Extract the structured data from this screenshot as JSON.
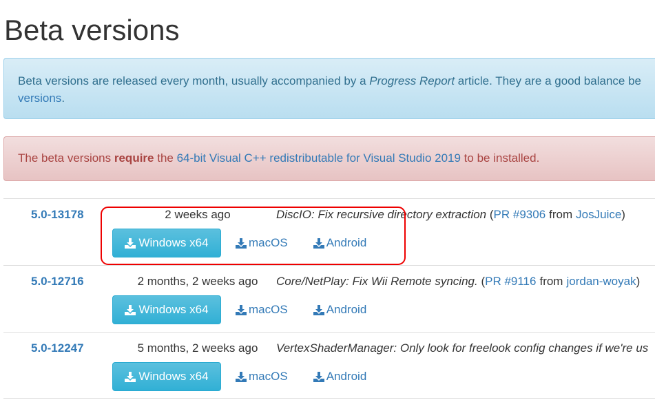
{
  "title": "Beta versions",
  "info": {
    "text1": "Beta versions are released every month, usually accompanied by a ",
    "em": "Progress Report",
    "text2": " article. They are a good balance be",
    "link": "versions",
    "end": "."
  },
  "danger": {
    "text1": "The beta versions ",
    "strong": "require",
    "text2": " the ",
    "link": "64-bit Visual C++ redistributable for Visual Studio 2019",
    "text3": " to be installed."
  },
  "colors": {
    "link": "#337ab7",
    "button": "#31b0d5",
    "highlight": "#e00000"
  },
  "buttons": {
    "windows": "Windows x64",
    "macos": "macOS",
    "android": "Android",
    "icon": "download-icon"
  },
  "rows": [
    {
      "version": "5.0-13178",
      "date": "2 weeks ago",
      "desc": "DiscIO: Fix recursive directory extraction",
      "pr": "PR #9306",
      "from": "from",
      "author": "JosJuice",
      "open": " (",
      "close": ")"
    },
    {
      "version": "5.0-12716",
      "date": "2 months, 2 weeks ago",
      "desc": "Core/NetPlay: Fix Wii Remote syncing.",
      "pr": "PR #9116",
      "from": "from",
      "author": "jordan-woyak",
      "open": " (",
      "close": ")"
    },
    {
      "version": "5.0-12247",
      "date": "5 months, 2 weeks ago",
      "desc": "VertexShaderManager: Only look for freelook config changes if we're us",
      "pr": "",
      "from": "",
      "author": "",
      "open": "",
      "close": ""
    }
  ]
}
